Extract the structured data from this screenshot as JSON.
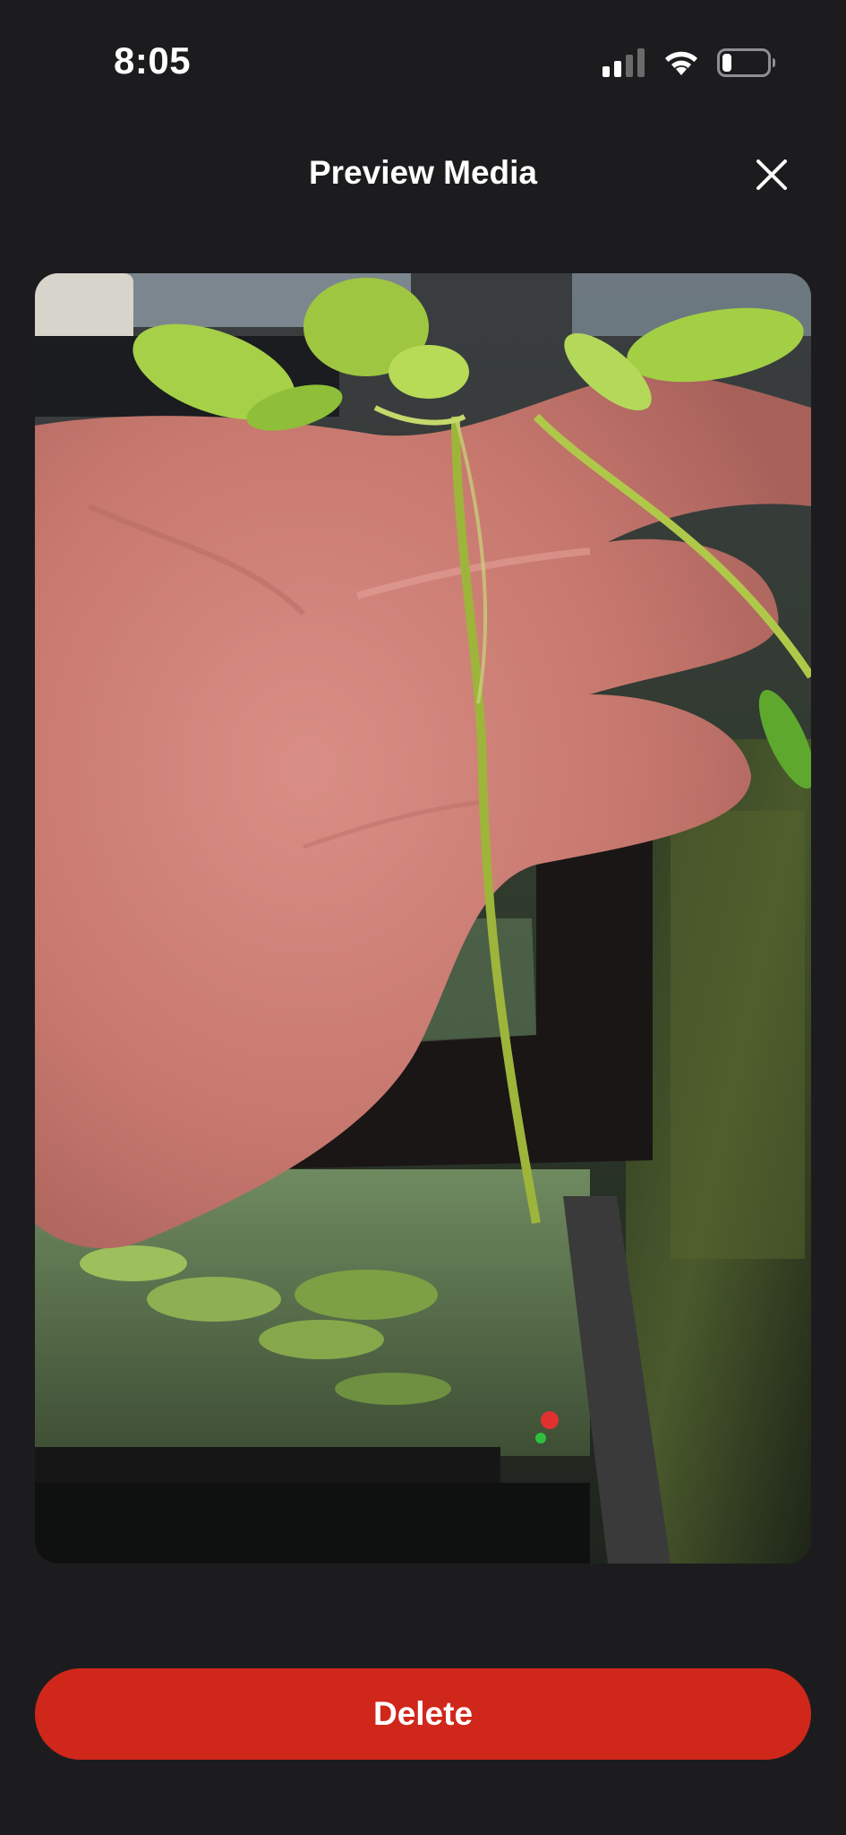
{
  "status_bar": {
    "time": "8:05",
    "icons": [
      "cellular-signal-icon",
      "wifi-icon",
      "battery-icon"
    ],
    "battery_level": 0.2
  },
  "header": {
    "title": "Preview Media",
    "close_icon": "close-icon"
  },
  "media": {
    "kind": "photo"
  },
  "actions": {
    "delete_label": "Delete"
  },
  "colors": {
    "background": "#1c1c1e",
    "delete_button": "#d0271b",
    "text": "#ffffff"
  }
}
